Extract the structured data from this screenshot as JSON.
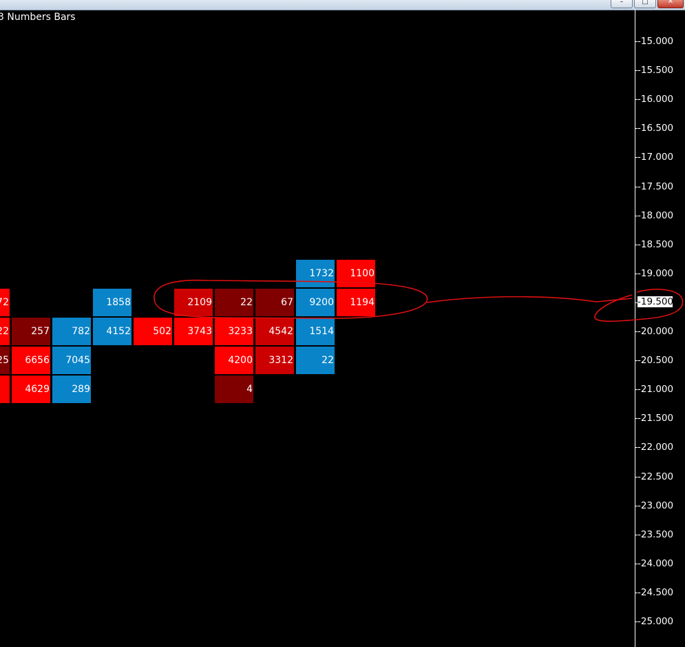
{
  "window": {
    "title": "",
    "minimize_glyph": "–",
    "maximize_glyph": "□",
    "close_glyph": "✕"
  },
  "chart": {
    "title": "3 Numbers Bars",
    "current_price": "-19.500",
    "colors": {
      "blue": "#0a84c8",
      "red": "#ff0000",
      "mid_red": "#cc0000",
      "dark_red": "#800000",
      "annotation": "#e01010"
    }
  },
  "chart_data": {
    "type": "heatmap",
    "title": "3 Numbers Bars",
    "y_ticks": [
      "-15.000",
      "-15.500",
      "-16.000",
      "-16.500",
      "-17.000",
      "-17.500",
      "-18.000",
      "-18.500",
      "-19.000",
      "-19.500",
      "-20.000",
      "-20.500",
      "-21.000",
      "-21.500",
      "-22.000",
      "-22.500",
      "-23.000",
      "-23.500",
      "-24.000",
      "-24.500",
      "-25.000"
    ],
    "ylim": [
      -25.0,
      -15.0
    ],
    "columns": 10,
    "cells": [
      {
        "col": 0,
        "price": -19.5,
        "value": "72",
        "color": "red"
      },
      {
        "col": 0,
        "price": -20.0,
        "value": "22",
        "color": "red"
      },
      {
        "col": 0,
        "price": -20.5,
        "value": "25",
        "color": "dark_red"
      },
      {
        "col": 0,
        "price": -21.0,
        "value": "",
        "color": "red"
      },
      {
        "col": 1,
        "price": -20.0,
        "value": "257",
        "color": "dark_red"
      },
      {
        "col": 1,
        "price": -20.5,
        "value": "6656",
        "color": "red"
      },
      {
        "col": 1,
        "price": -21.0,
        "value": "4629",
        "color": "red"
      },
      {
        "col": 2,
        "price": -20.0,
        "value": "782",
        "color": "blue"
      },
      {
        "col": 2,
        "price": -20.5,
        "value": "7045",
        "color": "blue"
      },
      {
        "col": 2,
        "price": -21.0,
        "value": "289",
        "color": "blue"
      },
      {
        "col": 3,
        "price": -19.5,
        "value": "1858",
        "color": "blue"
      },
      {
        "col": 3,
        "price": -20.0,
        "value": "4152",
        "color": "blue"
      },
      {
        "col": 4,
        "price": -20.0,
        "value": "502",
        "color": "red"
      },
      {
        "col": 5,
        "price": -19.5,
        "value": "2109",
        "color": "mid_red"
      },
      {
        "col": 5,
        "price": -20.0,
        "value": "3743",
        "color": "red"
      },
      {
        "col": 6,
        "price": -19.5,
        "value": "22",
        "color": "dark_red"
      },
      {
        "col": 6,
        "price": -20.0,
        "value": "3233",
        "color": "red"
      },
      {
        "col": 6,
        "price": -20.5,
        "value": "4200",
        "color": "red"
      },
      {
        "col": 6,
        "price": -21.0,
        "value": "4",
        "color": "dark_red"
      },
      {
        "col": 7,
        "price": -19.5,
        "value": "67",
        "color": "dark_red"
      },
      {
        "col": 7,
        "price": -20.0,
        "value": "4542",
        "color": "mid_red"
      },
      {
        "col": 7,
        "price": -20.5,
        "value": "3312",
        "color": "mid_red"
      },
      {
        "col": 8,
        "price": -19.0,
        "value": "1732",
        "color": "blue"
      },
      {
        "col": 8,
        "price": -19.5,
        "value": "9200",
        "color": "blue"
      },
      {
        "col": 8,
        "price": -20.0,
        "value": "1514",
        "color": "blue"
      },
      {
        "col": 8,
        "price": -20.5,
        "value": "22",
        "color": "blue"
      },
      {
        "col": 9,
        "price": -19.0,
        "value": "1100",
        "color": "red"
      },
      {
        "col": 9,
        "price": -19.5,
        "value": "1194",
        "color": "red"
      }
    ]
  }
}
